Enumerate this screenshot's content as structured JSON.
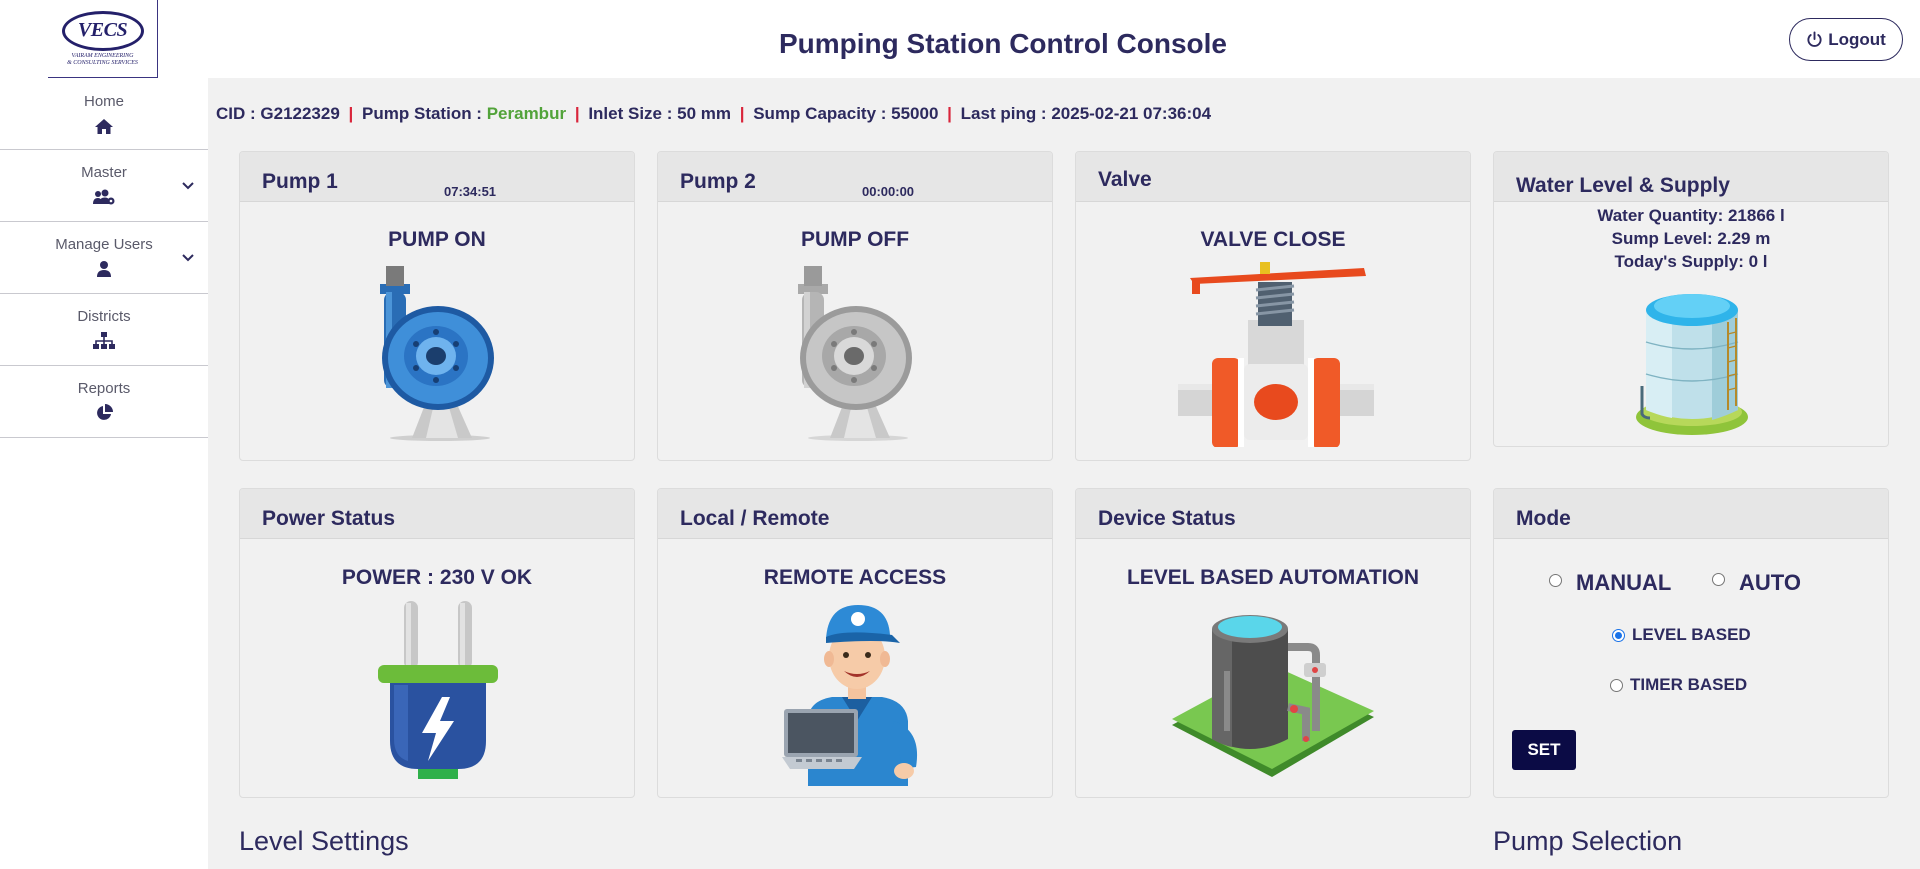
{
  "app": {
    "title": "Pumping Station Control Console",
    "logout_label": "Logout"
  },
  "logo": {
    "text": "VECS",
    "subtitle_line1": "VAIRAM ENGINEERING",
    "subtitle_line2": "& CONSULTING SERVICES"
  },
  "sidebar": {
    "items": [
      {
        "label": "Home",
        "icon": "home-icon",
        "has_submenu": false
      },
      {
        "label": "Master",
        "icon": "users-cog-icon",
        "has_submenu": true
      },
      {
        "label": "Manage Users",
        "icon": "user-icon",
        "has_submenu": true
      },
      {
        "label": "Districts",
        "icon": "sitemap-icon",
        "has_submenu": false
      },
      {
        "label": "Reports",
        "icon": "pie-chart-icon",
        "has_submenu": false
      }
    ]
  },
  "info": {
    "cid_label": "CID : ",
    "cid": "G2122329",
    "station_label": "Pump Station : ",
    "station": "Perambur",
    "inlet_label": "Inlet Size : ",
    "inlet": "50 mm",
    "sump_label": "Sump Capacity : ",
    "sump": "55000",
    "ping_label": "Last ping : ",
    "ping": "2025-02-21 07:36:04",
    "separator": "|"
  },
  "cards": {
    "pump1": {
      "title": "Pump 1",
      "timer": "07:34:51",
      "state": "PUMP ON"
    },
    "pump2": {
      "title": "Pump 2",
      "timer": "00:00:00",
      "state": "PUMP OFF"
    },
    "valve": {
      "title": "Valve",
      "state": "VALVE CLOSE"
    },
    "water": {
      "title": "Water Level & Supply",
      "quantity": "Water Quantity: 21866 l",
      "sump_level": "Sump Level: 2.29 m",
      "supply": "Today's Supply: 0 l"
    },
    "power": {
      "title": "Power Status",
      "state": "POWER : 230 V OK"
    },
    "access": {
      "title": "Local / Remote",
      "state": "REMOTE ACCESS"
    },
    "device": {
      "title": "Device Status",
      "state": "LEVEL BASED AUTOMATION"
    },
    "mode": {
      "title": "Mode",
      "manual_label": "MANUAL",
      "auto_label": "AUTO",
      "level_label": "LEVEL BASED",
      "timer_label": "TIMER BASED",
      "selected": "LEVEL BASED",
      "set_label": "SET"
    }
  },
  "sections": {
    "level_settings": "Level Settings",
    "pump_selection": "Pump Selection"
  },
  "colors": {
    "primary": "#2d2a5e",
    "accent_red": "#d9253b",
    "station_green": "#52a33a",
    "set_button": "#0b0b45"
  }
}
